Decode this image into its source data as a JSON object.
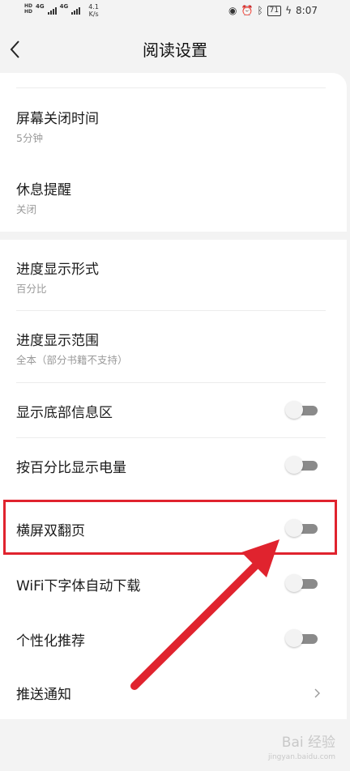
{
  "status_bar": {
    "hd1": "HD",
    "hd2": "HD",
    "net1": "4G",
    "net2": "4G",
    "speed_value": "4.1",
    "speed_unit": "K/s",
    "battery": "71",
    "time": "8:07"
  },
  "header": {
    "title": "阅读设置"
  },
  "settings_group1": [
    {
      "title": "屏幕关闭时间",
      "subtitle": "5分钟"
    },
    {
      "title": "休息提醒",
      "subtitle": "关闭"
    }
  ],
  "settings_group2": {
    "display_style": {
      "title": "进度显示形式",
      "subtitle": "百分比"
    },
    "display_range": {
      "title": "进度显示范围",
      "subtitle": "全本（部分书籍不支持）"
    },
    "show_bottom_info": {
      "title": "显示底部信息区",
      "enabled": false
    },
    "battery_percent": {
      "title": "按百分比显示电量",
      "enabled": false
    },
    "landscape_double_page": {
      "title": "横屏双翻页",
      "enabled": false
    },
    "wifi_font_download": {
      "title": "WiFi下字体自动下载",
      "enabled": false
    },
    "personalized": {
      "title": "个性化推荐",
      "enabled": false
    },
    "push": {
      "title": "推送通知"
    }
  },
  "annotation": {
    "highlight_color": "#e0232e",
    "arrow_color": "#e0232e"
  },
  "watermark": {
    "text": "Bai 经验",
    "sub": "jingyan.baidu.com"
  }
}
